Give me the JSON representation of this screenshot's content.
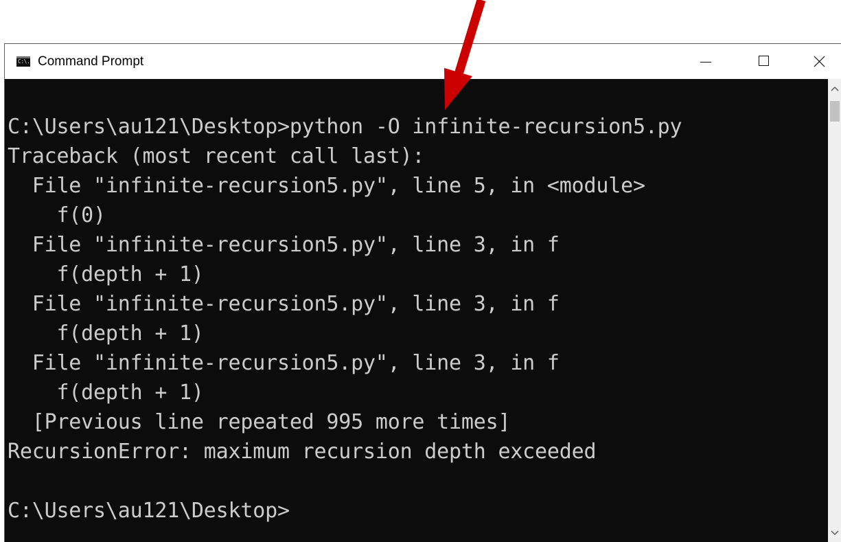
{
  "window": {
    "title": "Command Prompt",
    "icon": "cmd-icon",
    "icon_text": "C:\\."
  },
  "controls": {
    "minimize": "minimize-icon",
    "maximize": "maximize-icon",
    "close": "close-icon"
  },
  "console": {
    "lines": [
      "C:\\Users\\au121\\Desktop>python -O infinite-recursion5.py",
      "Traceback (most recent call last):",
      "  File \"infinite-recursion5.py\", line 5, in <module>",
      "    f(0)",
      "  File \"infinite-recursion5.py\", line 3, in f",
      "    f(depth + 1)",
      "  File \"infinite-recursion5.py\", line 3, in f",
      "    f(depth + 1)",
      "  File \"infinite-recursion5.py\", line 3, in f",
      "    f(depth + 1)",
      "  [Previous line repeated 995 more times]",
      "RecursionError: maximum recursion depth exceeded",
      "",
      "C:\\Users\\au121\\Desktop>"
    ]
  },
  "annotation": {
    "arrow_color": "#cc0000"
  },
  "colors": {
    "console_background": "#0c0c0c",
    "console_text": "#cccccc",
    "titlebar": "#ffffff"
  }
}
